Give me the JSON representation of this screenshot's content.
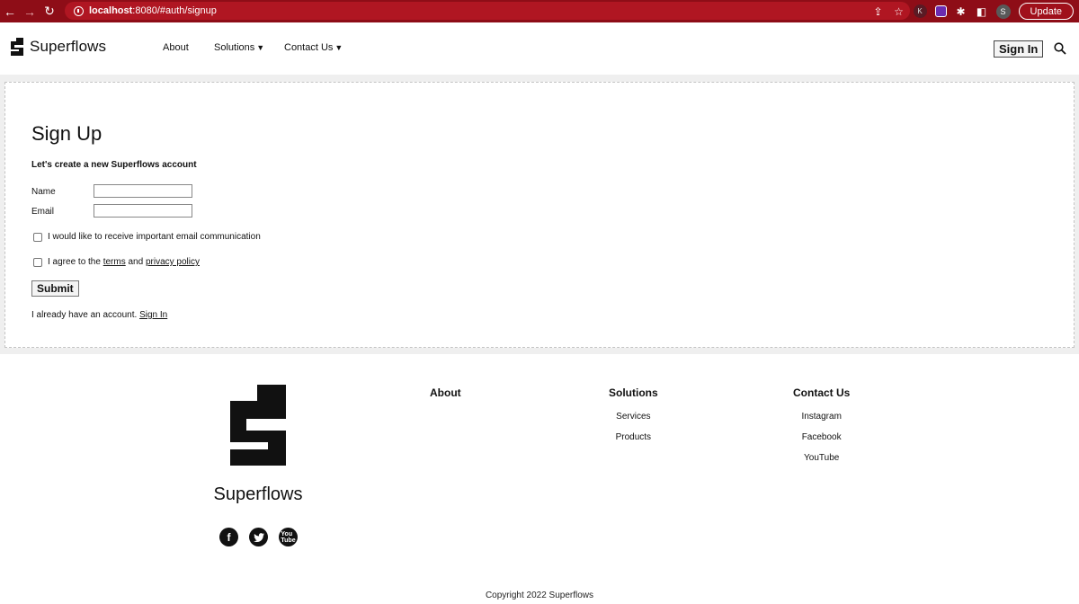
{
  "browser": {
    "url_host": "localhost",
    "url_rest": ":8080/#auth/signup",
    "profile_k": "K",
    "profile_s": "S",
    "update_label": "Update"
  },
  "header": {
    "brand": "Superflows",
    "nav": {
      "about": "About",
      "solutions": "Solutions",
      "contact": "Contact Us"
    },
    "signin_label": "Sign In"
  },
  "form": {
    "title": "Sign Up",
    "subtitle": "Let's create a new Superflows account",
    "name_label": "Name",
    "name_value": "",
    "email_label": "Email",
    "email_value": "",
    "checkbox_email": "I would like to receive important email communication",
    "checkbox_terms_prefix": "I agree to the ",
    "terms_link": "terms",
    "terms_and": " and ",
    "privacy_link": "privacy policy",
    "submit_label": "Submit",
    "already_text": "I already have an account. ",
    "already_link": "Sign In"
  },
  "footer": {
    "brand": "Superflows",
    "columns": {
      "about": {
        "heading": "About"
      },
      "solutions": {
        "heading": "Solutions",
        "links": [
          "Services",
          "Products"
        ]
      },
      "contact": {
        "heading": "Contact Us",
        "links": [
          "Instagram",
          "Facebook",
          "YouTube"
        ]
      }
    },
    "socials": [
      "facebook-icon",
      "twitter-icon",
      "youtube-icon"
    ],
    "copyright": "Copyright 2022 Superflows"
  },
  "colors": {
    "chrome_bg": "#8e0d17",
    "page_bg": "#efefef"
  }
}
